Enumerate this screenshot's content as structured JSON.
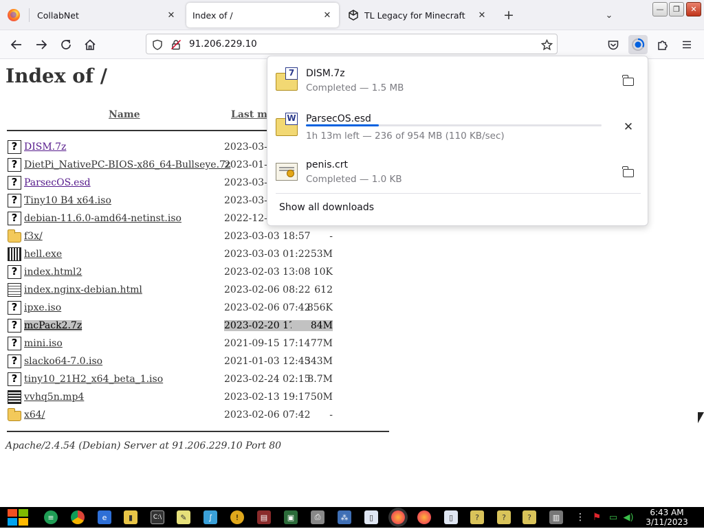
{
  "browser": {
    "tabs": [
      {
        "title": "CollabNet",
        "active": false
      },
      {
        "title": "Index of /",
        "active": true
      },
      {
        "title": "TL Legacy for Minecraft",
        "active": false
      }
    ],
    "close_glyph": "✕",
    "new_tab_glyph": "+",
    "list_tabs_glyph": "⌄",
    "window_buttons": {
      "minimize": "—",
      "restore": "❐",
      "close": "✕"
    },
    "url": "91.206.229.10",
    "icons": [
      "firefox-icon",
      "back-icon",
      "forward-icon",
      "reload-icon",
      "home-icon",
      "shield-icon",
      "lock-icon",
      "star-icon",
      "pocket-icon",
      "downloads-icon",
      "extensions-icon",
      "menu-icon"
    ]
  },
  "page": {
    "title": "Index of /",
    "columns": {
      "name": "Name",
      "last_modified": "Last modified"
    },
    "files": [
      {
        "name": "DISM.7z",
        "date": "2023-03-",
        "size": "",
        "icon": "unknown",
        "visited": true
      },
      {
        "name": "DietPi_NativePC-BIOS-x86_64-Bullseye.7z",
        "date": "2023-01-",
        "size": "",
        "icon": "unknown",
        "visited": false
      },
      {
        "name": "ParsecOS.esd",
        "date": "2023-03-",
        "size": "",
        "icon": "unknown",
        "visited": true
      },
      {
        "name": "Tiny10 B4 x64.iso",
        "date": "2023-03-",
        "size": "",
        "icon": "unknown",
        "visited": false
      },
      {
        "name": "debian-11.6.0-amd64-netinst.iso",
        "date": "2022-12-",
        "size": "",
        "icon": "unknown",
        "visited": false
      },
      {
        "name": "f3x/",
        "date": "2023-03-03 18:57",
        "size": "-",
        "icon": "folder",
        "visited": false
      },
      {
        "name": "hell.exe",
        "date": "2023-03-03 01:22",
        "size": "53M",
        "icon": "binary",
        "visited": false
      },
      {
        "name": "index.html2",
        "date": "2023-02-03 13:08",
        "size": "10K",
        "icon": "unknown",
        "visited": false
      },
      {
        "name": "index.nginx-debian.html",
        "date": "2023-02-06 08:22",
        "size": "612",
        "icon": "text",
        "visited": false
      },
      {
        "name": "ipxe.iso",
        "date": "2023-02-06 07:42",
        "size": "856K",
        "icon": "unknown",
        "visited": false
      },
      {
        "name": "mcPack2.7z",
        "date": "2023-02-20 17:24",
        "size": "84M",
        "icon": "unknown",
        "visited": false,
        "selected": true
      },
      {
        "name": "mini.iso",
        "date": "2021-09-15 17:14",
        "size": "77M",
        "icon": "unknown",
        "visited": false
      },
      {
        "name": "slacko64-7.0.iso",
        "date": "2021-01-03 12:45",
        "size": "343M",
        "icon": "unknown",
        "visited": false
      },
      {
        "name": "tiny10_21H2_x64_beta_1.iso",
        "date": "2023-02-24 02:15",
        "size": "8.7M",
        "icon": "unknown",
        "visited": false
      },
      {
        "name": "vvhq5n.mp4",
        "date": "2023-02-13 19:17",
        "size": "50M",
        "icon": "movie",
        "visited": false
      },
      {
        "name": "x64/",
        "date": "2023-02-06 07:42",
        "size": "-",
        "icon": "folder",
        "visited": false
      }
    ],
    "address": "Apache/2.4.54 (Debian) Server at 91.206.229.10 Port 80"
  },
  "downloads": {
    "items": [
      {
        "name": "DISM.7z",
        "status": "Completed — 1.5 MB",
        "badge": "7",
        "action": "folder"
      },
      {
        "name": "ParsecOS.esd",
        "status": "1h 13m left — 236 of 954 MB (110 KB/sec)",
        "badge": "W",
        "action": "cancel",
        "progress_fraction": 0.247
      },
      {
        "name": "penis.crt",
        "status": "Completed — 1.0 KB",
        "badge": "",
        "action": "folder"
      }
    ],
    "show_all": "Show all downloads",
    "cancel_glyph": "✕"
  },
  "taskbar": {
    "time": "6:43 AM",
    "date": "3/11/2023",
    "start_colors": [
      "#f25022",
      "#7fba00",
      "#00a4ef",
      "#ffb900"
    ]
  }
}
